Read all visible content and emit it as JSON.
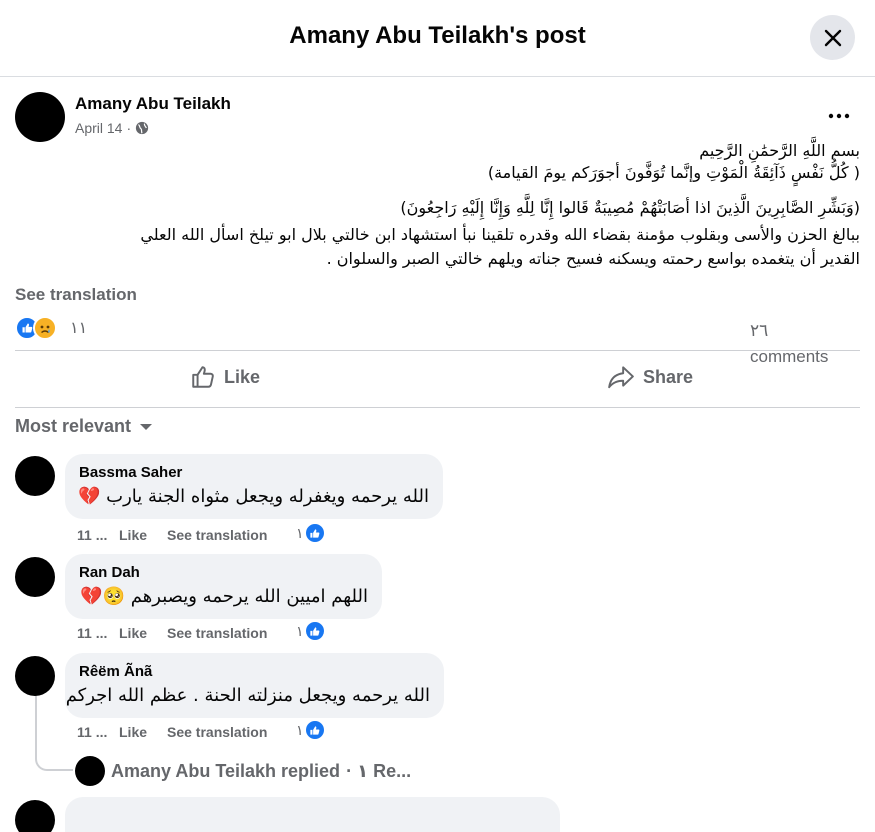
{
  "header": {
    "title": "Amany Abu Teilakh's post"
  },
  "post": {
    "author": "Amany Abu Teilakh",
    "date": "April 14",
    "lines": [
      "بسم اللَّهِ الرَّحمَٰنِ الرَّحِيم",
      "( كُلُّ نَفْسٍ ذَآئِقَةُ الْمَوْتِ وإنَّما تُوَفَّونَ أجوَرَكم يومَ القيامة)",
      "(وَبَشِّرِ الصَّابِرِينَ الَّذِينَ اذا أصَابَتْهُمْ مُصِيبَةٌ قَالوا إِنَّا لِلَّهِ وَإِنَّا إِلَيْهِ رَاجِعُونَ)",
      "ببالغ الحزن والأسى وبقلوب مؤمنة بقضاء الله وقدره تلقينا نبأ استشهاد ابن خالتي بلال ابو تيلخ اسأل الله العلي",
      "القدير أن يتغمده بواسع رحمته ويسكنه فسيح جناته ويلهم خالتي الصبر والسلوان ."
    ],
    "see_translation": "See translation",
    "reaction_count": "١١",
    "comments_count_num": "٢٦",
    "comments_count_label": "comments",
    "like_label": "Like",
    "share_label": "Share"
  },
  "sort": {
    "label": "Most relevant"
  },
  "comments": [
    {
      "name": "Bassma Saher",
      "text": "الله يرحمه ويغفرله ويجعل مثواه الجنة يارب 💔",
      "time": "11 ...",
      "like": "Like",
      "translate": "See translation",
      "react_count": "١"
    },
    {
      "name": "Ran Dah",
      "text": "اللهم اميين الله يرحمه ويصبرهم 🥺💔",
      "time": "11 ...",
      "like": "Like",
      "translate": "See translation",
      "react_count": "١"
    },
    {
      "name": "Rêëm Ãnã",
      "text": "الله يرحمه ويجعل منزلته الحنة . عظم الله اجركم",
      "time": "11 ...",
      "like": "Like",
      "translate": "See translation",
      "react_count": "١"
    }
  ],
  "reply_summary": {
    "text": "Amany Abu Teilakh replied",
    "count": "· ١ Re..."
  },
  "icons": {
    "close": "close-icon",
    "globe": "globe-icon",
    "more": "more-icon",
    "like": "like-icon",
    "share": "share-icon",
    "caret": "caret-down-icon"
  },
  "colors": {
    "accent": "#1877f2",
    "muted": "#65676b",
    "bubble": "#f0f2f5"
  }
}
